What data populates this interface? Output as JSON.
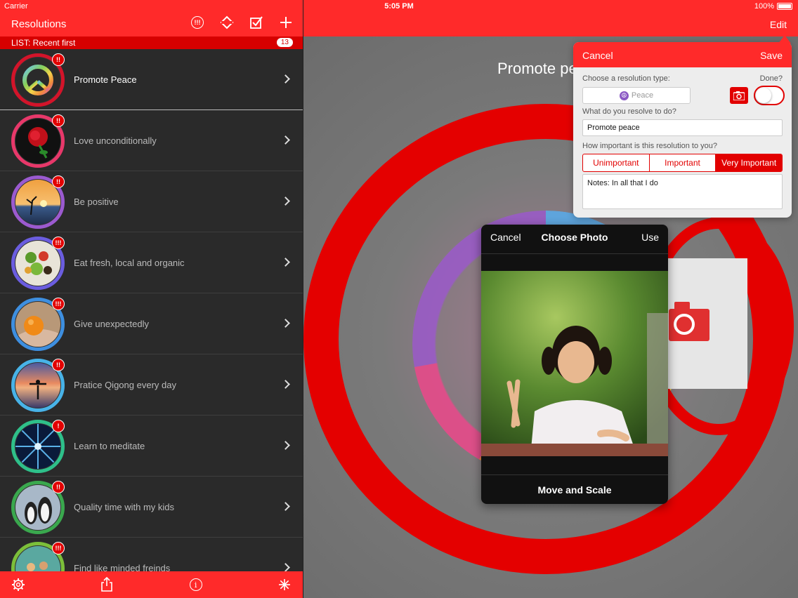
{
  "status": {
    "carrier": "Carrier",
    "time": "5:05 PM",
    "battery": "100%"
  },
  "left": {
    "title": "Resolutions",
    "header_icons": [
      "priority-icon",
      "sort-icon",
      "checklist-icon",
      "add-icon"
    ],
    "list_label": "LIST: Recent first",
    "count": "13",
    "items": [
      {
        "label": "Promote Peace",
        "badge": "!!",
        "ring": "#d3142a"
      },
      {
        "label": "Love unconditionally",
        "badge": "!!",
        "ring": "#e8386a"
      },
      {
        "label": "Be positive",
        "badge": "!!",
        "ring": "#9b5ad0"
      },
      {
        "label": "Eat fresh, local and organic",
        "badge": "!!!",
        "ring": "#6b5de0"
      },
      {
        "label": "Give unexpectedly",
        "badge": "!!!",
        "ring": "#3e8fe0"
      },
      {
        "label": "Pratice Qigong every day",
        "badge": "!!",
        "ring": "#48b3e8"
      },
      {
        "label": "Learn to meditate",
        "badge": "!",
        "ring": "#2ec08a"
      },
      {
        "label": "Quality time with my kids",
        "badge": "!!",
        "ring": "#3aa84e"
      },
      {
        "label": "Find like minded freinds",
        "badge": "!!!",
        "ring": "#7cbf3a"
      }
    ],
    "footer_icons": [
      "settings-icon",
      "share-icon",
      "info-icon",
      "asterisk-icon"
    ]
  },
  "right": {
    "edit_label": "Edit",
    "title": "Promote pe"
  },
  "popover": {
    "cancel": "Cancel",
    "save": "Save",
    "type_label": "Choose a resolution type:",
    "done_label": "Done?",
    "type_value": "Peace",
    "resolve_label": "What do you resolve to do?",
    "resolve_value": "Promote peace",
    "importance_label": "How important is this resolution to you?",
    "importance_options": [
      "Unimportant",
      "Important",
      "Very Important"
    ],
    "importance_selected": "Very Important",
    "notes": "Notes: In all that I do"
  },
  "photo": {
    "cancel": "Cancel",
    "title": "Choose Photo",
    "use": "Use",
    "footer": "Move and Scale"
  }
}
